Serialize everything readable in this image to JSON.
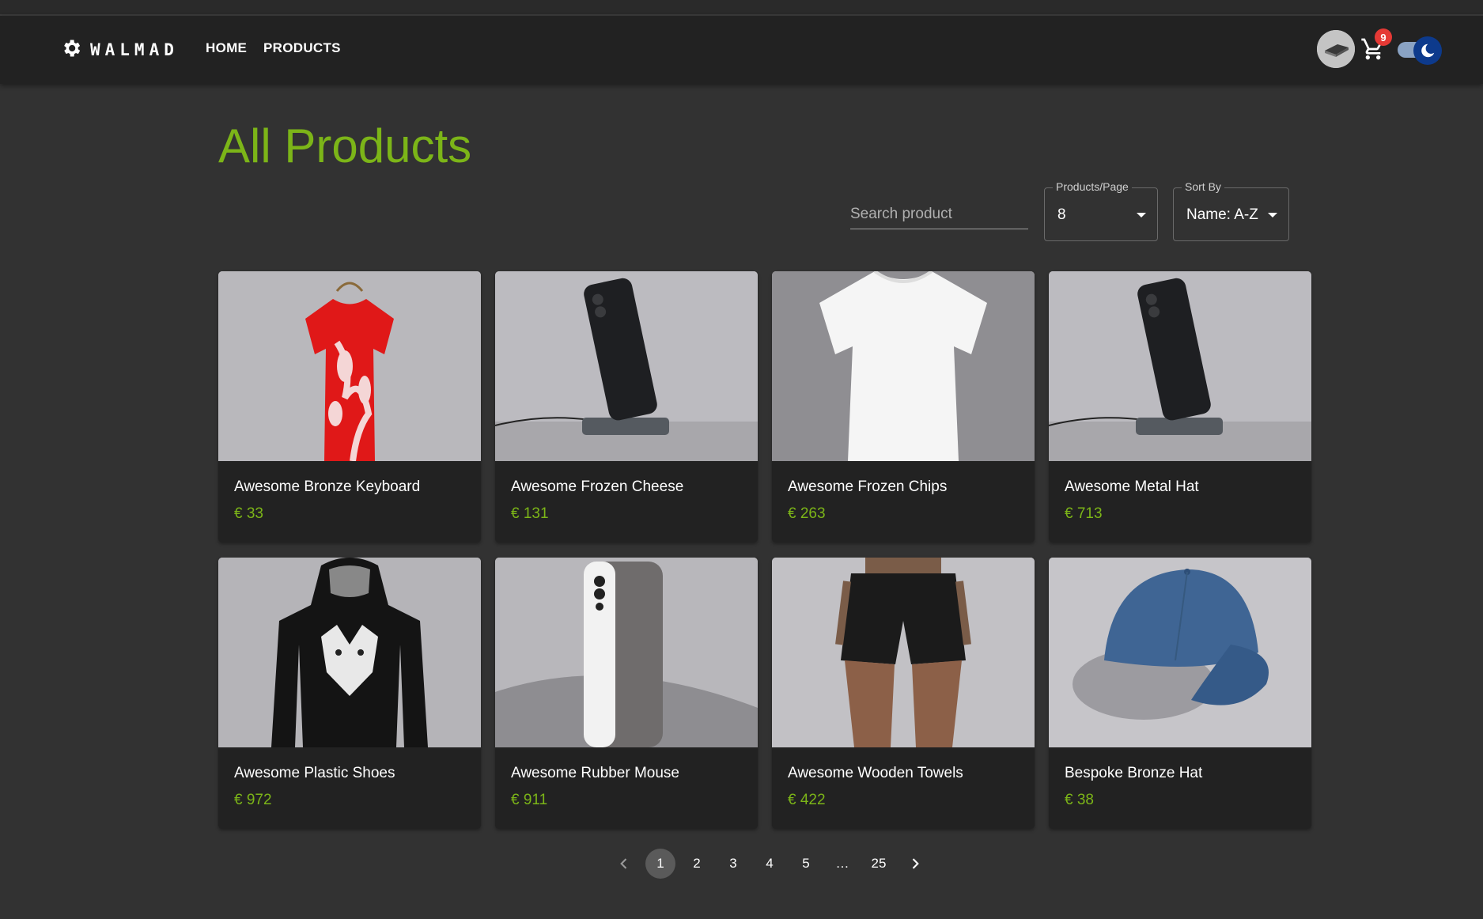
{
  "app": {
    "brand": "WALMAD"
  },
  "nav": {
    "home": "HOME",
    "products": "PRODUCTS"
  },
  "header": {
    "cart_count": "9"
  },
  "page": {
    "title": "All Products"
  },
  "filters": {
    "search_placeholder": "Search product",
    "per_page_label": "Products/Page",
    "per_page_value": "8",
    "sort_label": "Sort By",
    "sort_value": "Name: A-Z"
  },
  "products": [
    {
      "name": "Awesome Bronze Keyboard",
      "price": "€ 33",
      "image": "red-tshirt"
    },
    {
      "name": "Awesome Frozen Cheese",
      "price": "€ 131",
      "image": "phone-on-stand"
    },
    {
      "name": "Awesome Frozen Chips",
      "price": "€ 263",
      "image": "white-tshirt"
    },
    {
      "name": "Awesome Metal Hat",
      "price": "€ 713",
      "image": "phone-on-stand"
    },
    {
      "name": "Awesome Plastic Shoes",
      "price": "€ 972",
      "image": "wolf-hoodie"
    },
    {
      "name": "Awesome Rubber Mouse",
      "price": "€ 911",
      "image": "silver-phone"
    },
    {
      "name": "Awesome Wooden Towels",
      "price": "€ 422",
      "image": "black-shorts"
    },
    {
      "name": "Bespoke Bronze Hat",
      "price": "€ 38",
      "image": "blue-cap"
    }
  ],
  "pagination": {
    "pages": [
      "1",
      "2",
      "3",
      "4",
      "5",
      "…",
      "25"
    ],
    "current": "1"
  },
  "colors": {
    "accent": "#7cb518",
    "appbar": "#222222",
    "background": "#323232",
    "badge": "#e53935"
  }
}
